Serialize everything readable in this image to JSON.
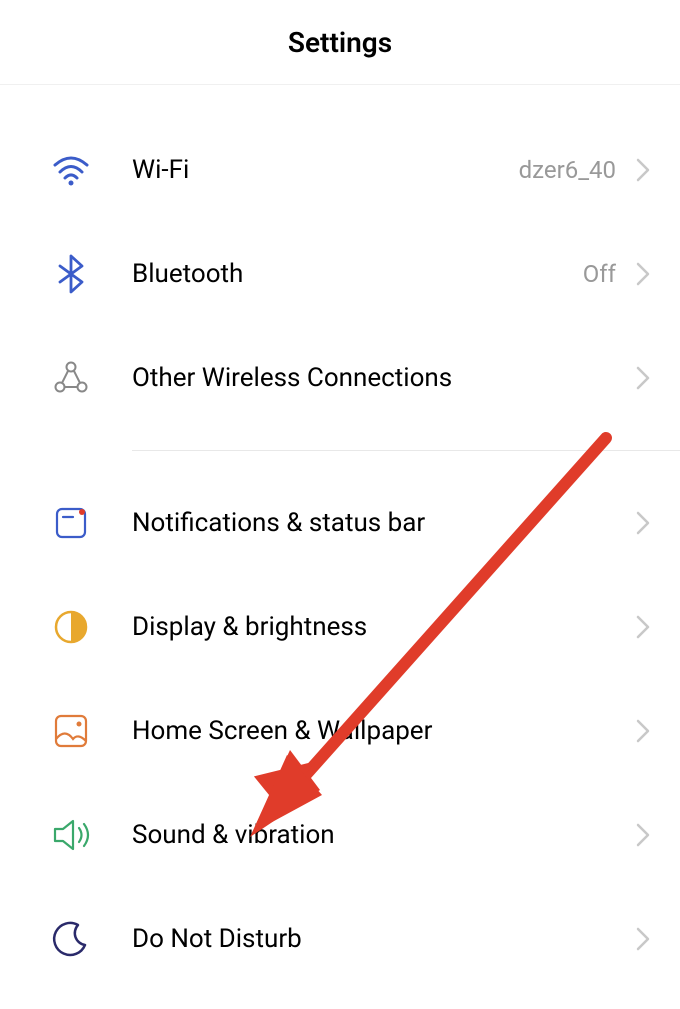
{
  "header": {
    "title": "Settings"
  },
  "groups": [
    {
      "rows": [
        {
          "icon": "wifi-icon",
          "label": "Wi-Fi",
          "value": "dzer6_40"
        },
        {
          "icon": "bluetooth-icon",
          "label": "Bluetooth",
          "value": "Off"
        },
        {
          "icon": "wireless-connections-icon",
          "label": "Other Wireless Connections",
          "value": ""
        }
      ]
    },
    {
      "rows": [
        {
          "icon": "notifications-icon",
          "label": "Notifications & status bar",
          "value": ""
        },
        {
          "icon": "display-icon",
          "label": "Display & brightness",
          "value": ""
        },
        {
          "icon": "home-screen-icon",
          "label": "Home Screen & Wallpaper",
          "value": ""
        },
        {
          "icon": "sound-icon",
          "label": "Sound & vibration",
          "value": ""
        },
        {
          "icon": "dnd-icon",
          "label": "Do Not Disturb",
          "value": ""
        }
      ]
    }
  ],
  "annotation": {
    "arrow_color": "#e03c2a"
  }
}
